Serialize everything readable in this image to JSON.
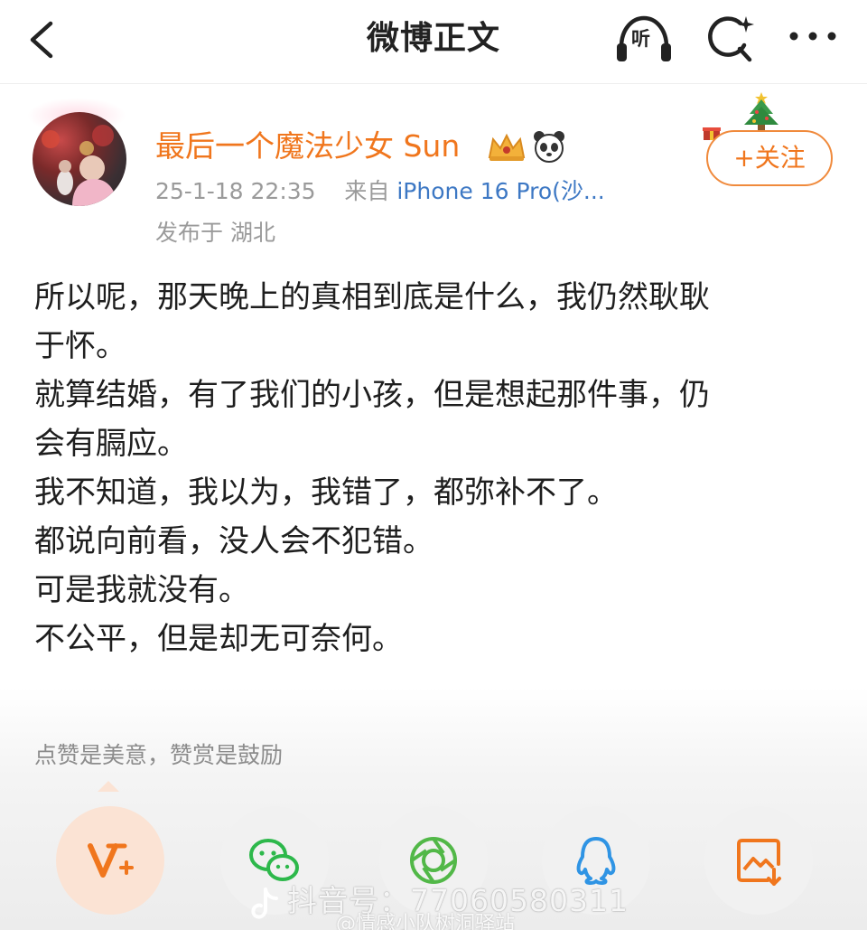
{
  "nav": {
    "title": "微博正文",
    "listen_label": "听",
    "icons": [
      "back-arrow-icon",
      "headphones-icon",
      "search-sparkle-icon",
      "more-dots-icon"
    ]
  },
  "post": {
    "author": "最后一个魔法少女 Sun",
    "author_color": "#f0761d",
    "badges": [
      "crown-icon",
      "panda-icon"
    ],
    "time": "25-1-18 22:35",
    "source_prefix": "来自",
    "source": "iPhone 16 Pro(沙...",
    "location": "发布于 湖北",
    "follow_label": "+关注",
    "lines": [
      "所以呢，那天晚上的真相到底是什么，我仍然耿耿",
      "于怀。",
      "就算结婚，有了我们的小孩，但是想起那件事，仍",
      "会有膈应。",
      "我不知道，我以为，我错了，都弥补不了。",
      "都说向前看，没人会不犯错。",
      "可是我就没有。",
      "不公平，但是却无可奈何。"
    ]
  },
  "tip": "点赞是美意，赞赏是鼓励",
  "share": [
    {
      "name": "reward-icon",
      "color": "#f0761d",
      "active": true
    },
    {
      "name": "wechat-icon",
      "color": "#2db84b",
      "active": false
    },
    {
      "name": "moments-icon",
      "color": "#52b848",
      "active": false
    },
    {
      "name": "qq-icon",
      "color": "#2f94e4",
      "active": false
    },
    {
      "name": "save-image-icon",
      "color": "#f0761d",
      "active": false
    }
  ],
  "watermark": {
    "line1": "抖音号：77060580311",
    "line2": "@情感小队树洞驿站",
    "icon": "douyin-logo-icon"
  }
}
